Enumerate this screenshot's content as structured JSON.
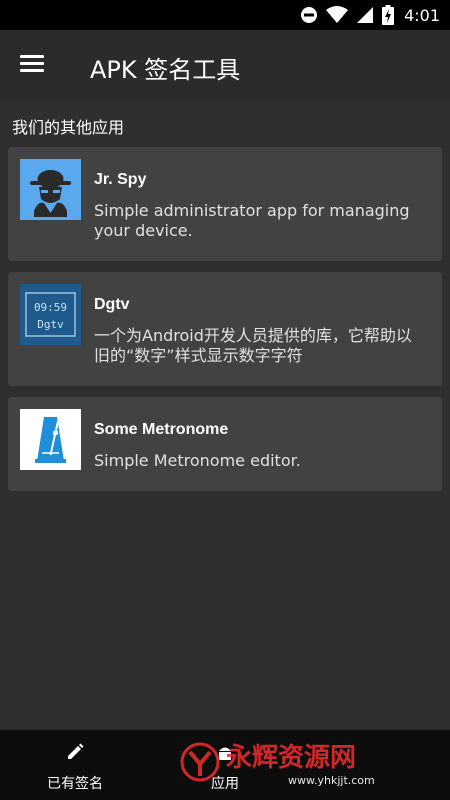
{
  "status_bar": {
    "time": "4:01",
    "icons": [
      "do-not-disturb-icon",
      "wifi-icon",
      "signal-icon",
      "battery-charging-icon"
    ]
  },
  "app_bar": {
    "title": "APK 签名工具",
    "menu_icon": "hamburger-menu-icon"
  },
  "section": {
    "title": "我们的其他应用"
  },
  "apps": [
    {
      "name": "Jr. Spy",
      "description": "Simple administrator app for managing your device.",
      "icon": "spy-icon",
      "icon_bg": "#5aa9ef"
    },
    {
      "name": "Dgtv",
      "description": "一个为Android开发人员提供的库，它帮助以旧的“数字”样式显示数字字符",
      "icon": "digital-clock-icon",
      "icon_bg": "#1e5a8c",
      "icon_text_top": "09:59",
      "icon_text_bottom": "Dgtv"
    },
    {
      "name": "Some Metronome",
      "description": "Simple Metronome editor.",
      "icon": "metronome-icon",
      "icon_bg": "#ffffff"
    }
  ],
  "bottom_nav": {
    "items": [
      {
        "label": "已有签名",
        "icon": "pencil-icon"
      },
      {
        "label": "应用",
        "icon": "android-icon"
      }
    ]
  },
  "watermark": {
    "text": "永辉资源网",
    "url": "www.yhkjjt.com"
  },
  "colors": {
    "background": "#2f2f2f",
    "card": "#424242",
    "app_bar": "#2b2b2b",
    "bottom_bar": "#0d0d0d",
    "watermark_red": "#e52b2b"
  }
}
